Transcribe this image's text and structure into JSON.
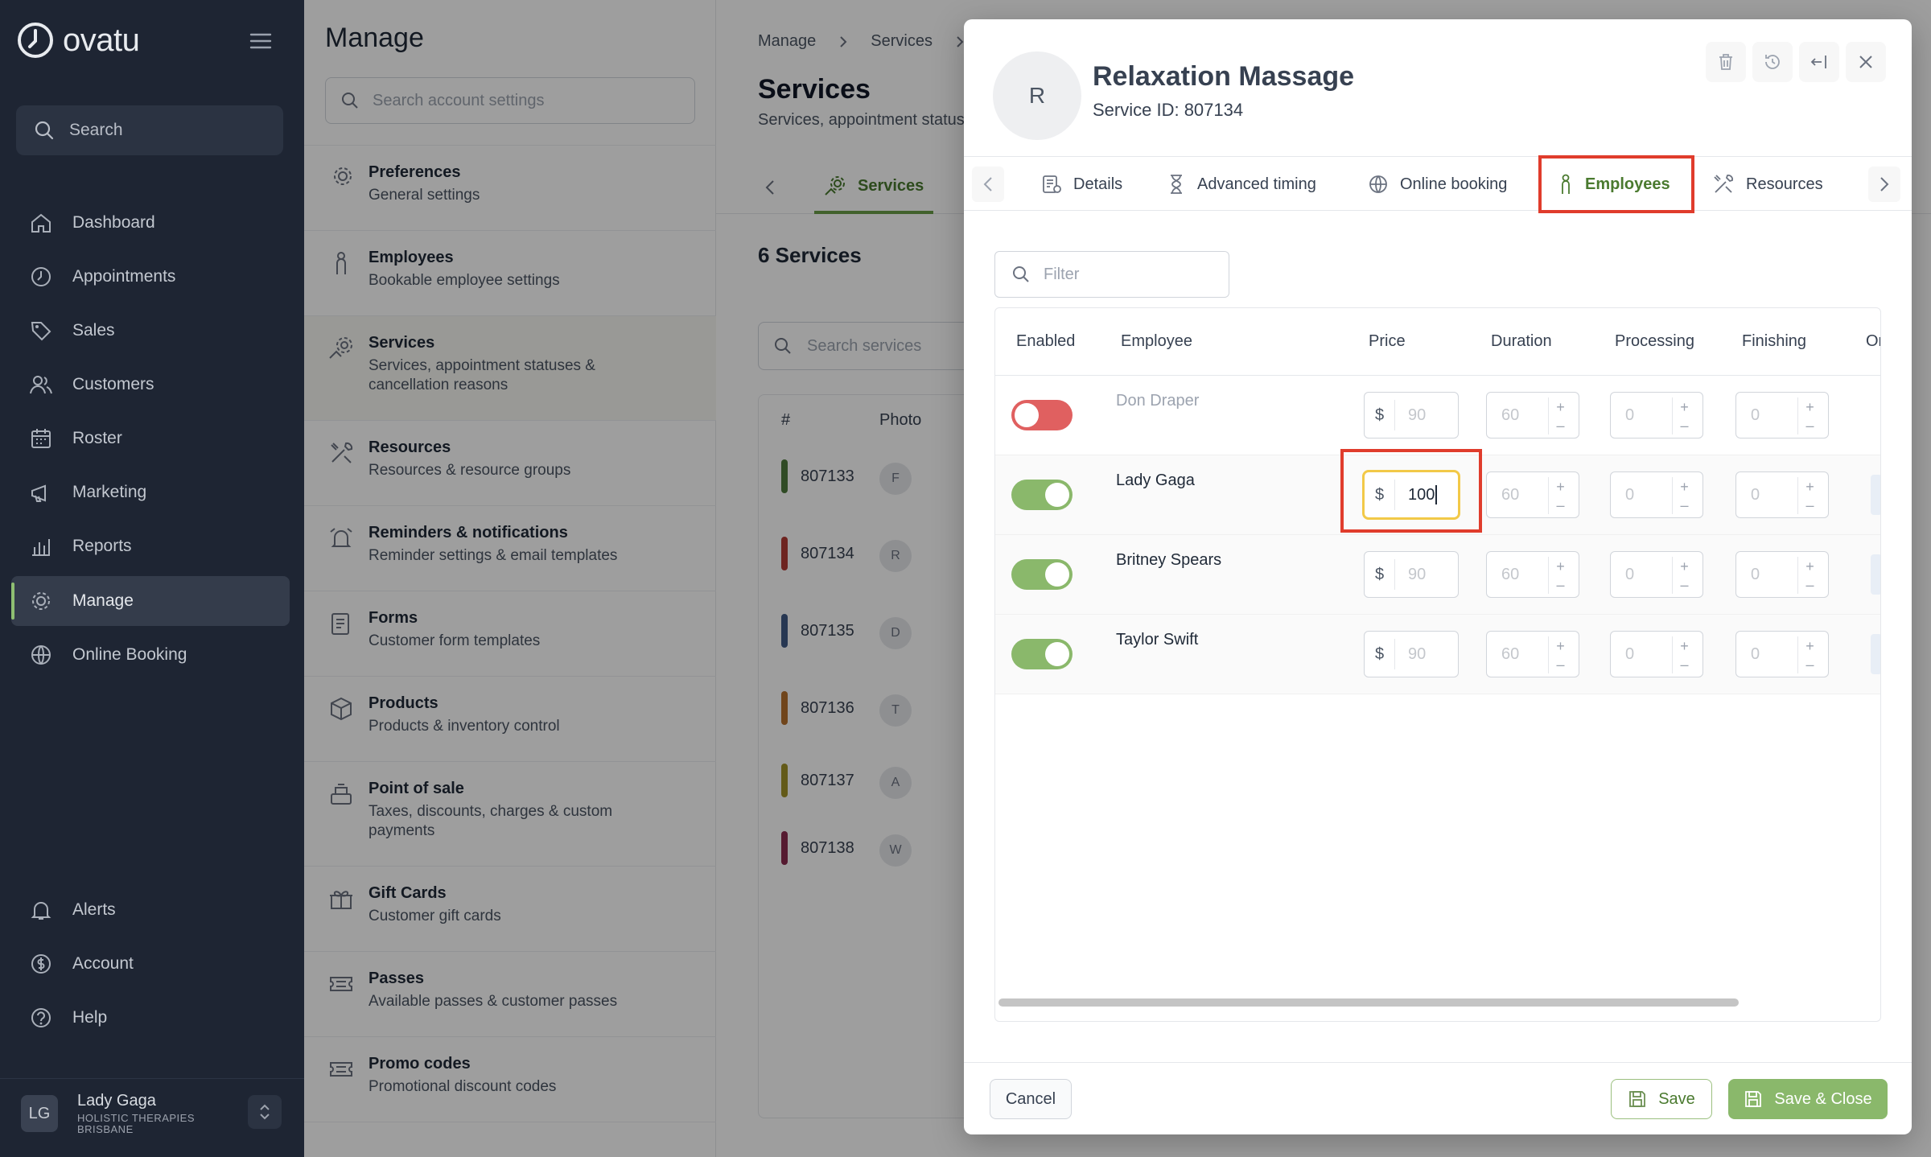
{
  "app": {
    "name": "ovatu"
  },
  "sidebar": {
    "search_label": "Search",
    "items": [
      {
        "label": "Dashboard",
        "icon": "home-icon"
      },
      {
        "label": "Appointments",
        "icon": "clock-icon"
      },
      {
        "label": "Sales",
        "icon": "tag-icon"
      },
      {
        "label": "Customers",
        "icon": "users-icon"
      },
      {
        "label": "Roster",
        "icon": "calendar-icon"
      },
      {
        "label": "Marketing",
        "icon": "megaphone-icon"
      },
      {
        "label": "Reports",
        "icon": "chart-icon"
      },
      {
        "label": "Manage",
        "icon": "gear-icon"
      },
      {
        "label": "Online Booking",
        "icon": "globe-icon"
      }
    ],
    "bottom_items": [
      {
        "label": "Alerts",
        "icon": "bell-icon"
      },
      {
        "label": "Account",
        "icon": "dollar-icon"
      },
      {
        "label": "Help",
        "icon": "help-icon"
      }
    ],
    "user": {
      "initials": "LG",
      "name": "Lady Gaga",
      "business": "HOLISTIC THERAPIES",
      "location": "BRISBANE"
    }
  },
  "manage": {
    "title": "Manage",
    "search_placeholder": "Search account settings",
    "items": [
      {
        "title": "Preferences",
        "subtitle": "General settings"
      },
      {
        "title": "Employees",
        "subtitle": "Bookable employee settings"
      },
      {
        "title": "Services",
        "subtitle": "Services, appointment statuses & cancellation reasons"
      },
      {
        "title": "Resources",
        "subtitle": "Resources & resource groups"
      },
      {
        "title": "Reminders & notifications",
        "subtitle": "Reminder settings & email templates"
      },
      {
        "title": "Forms",
        "subtitle": "Customer form templates"
      },
      {
        "title": "Products",
        "subtitle": "Products & inventory control"
      },
      {
        "title": "Point of sale",
        "subtitle": "Taxes, discounts, charges & custom payments"
      },
      {
        "title": "Gift Cards",
        "subtitle": "Customer gift cards"
      },
      {
        "title": "Passes",
        "subtitle": "Available passes & customer passes"
      },
      {
        "title": "Promo codes",
        "subtitle": "Promotional discount codes"
      }
    ]
  },
  "services_page": {
    "breadcrumb": [
      "Manage",
      "Services"
    ],
    "title": "Services",
    "subtitle": "Services, appointment status",
    "tab": "Services",
    "count": "6 Services",
    "search_placeholder": "Search services",
    "columns": [
      "#",
      "Photo"
    ],
    "rows": [
      {
        "id": "807133",
        "initial": "F",
        "color": "#4e7a3c"
      },
      {
        "id": "807134",
        "initial": "R",
        "color": "#b23a35"
      },
      {
        "id": "807135",
        "initial": "D",
        "color": "#3f5a85"
      },
      {
        "id": "807136",
        "initial": "T",
        "color": "#b5702c"
      },
      {
        "id": "807137",
        "initial": "A",
        "color": "#a19228"
      },
      {
        "id": "807138",
        "initial": "W",
        "color": "#8a2a4e"
      }
    ]
  },
  "modal": {
    "avatar_initial": "R",
    "title": "Relaxation Massage",
    "service_id": "Service ID: 807134",
    "tabs": [
      {
        "label": "Details",
        "icon": "details-icon"
      },
      {
        "label": "Advanced timing",
        "icon": "hourglass-icon"
      },
      {
        "label": "Online booking",
        "icon": "globe-icon"
      },
      {
        "label": "Employees",
        "icon": "employee-icon",
        "active": true
      },
      {
        "label": "Resources",
        "icon": "tools-icon"
      }
    ],
    "filter_placeholder": "Filter",
    "columns": [
      "Enabled",
      "Employee",
      "Price",
      "Duration",
      "Processing",
      "Finishing",
      "Or"
    ],
    "currency": "$",
    "employees": [
      {
        "name": "Don Draper",
        "enabled": false,
        "price": "90",
        "duration": "60",
        "processing": "0",
        "finishing": "0"
      },
      {
        "name": "Lady Gaga",
        "enabled": true,
        "price": "100",
        "duration": "60",
        "processing": "0",
        "finishing": "0"
      },
      {
        "name": "Britney Spears",
        "enabled": true,
        "price": "90",
        "duration": "60",
        "processing": "0",
        "finishing": "0"
      },
      {
        "name": "Taylor Swift",
        "enabled": true,
        "price": "90",
        "duration": "60",
        "processing": "0",
        "finishing": "0"
      }
    ],
    "footer": {
      "cancel": "Cancel",
      "save": "Save",
      "save_close": "Save & Close"
    }
  }
}
